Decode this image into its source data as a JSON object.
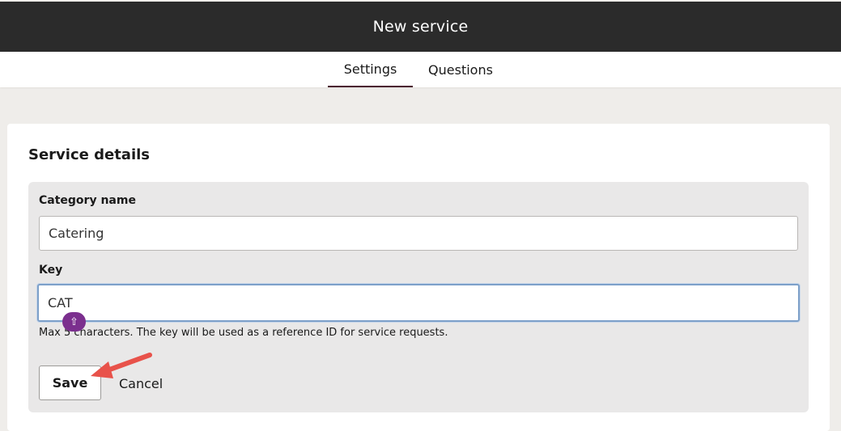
{
  "header": {
    "title": "New service"
  },
  "tabs": [
    {
      "label": "Settings",
      "active": true
    },
    {
      "label": "Questions",
      "active": false
    }
  ],
  "section": {
    "title": "Service details"
  },
  "form": {
    "category": {
      "label": "Category name",
      "value": "Catering"
    },
    "key": {
      "label": "Key",
      "value": "CAT",
      "helper": "Max 5 characters. The key will be used as a reference ID for service requests."
    }
  },
  "actions": {
    "save_label": "Save",
    "cancel_label": "Cancel"
  },
  "colors": {
    "header_bg": "#2b2b2b",
    "tab_underline": "#4a1730",
    "focus_border": "#7da0c9",
    "annotation_arrow": "#e8524a",
    "cursor_badge": "#7b2f8e"
  },
  "icons": {
    "cursor_badge": "shift-arrow-icon",
    "annotation": "red-arrow-icon"
  }
}
